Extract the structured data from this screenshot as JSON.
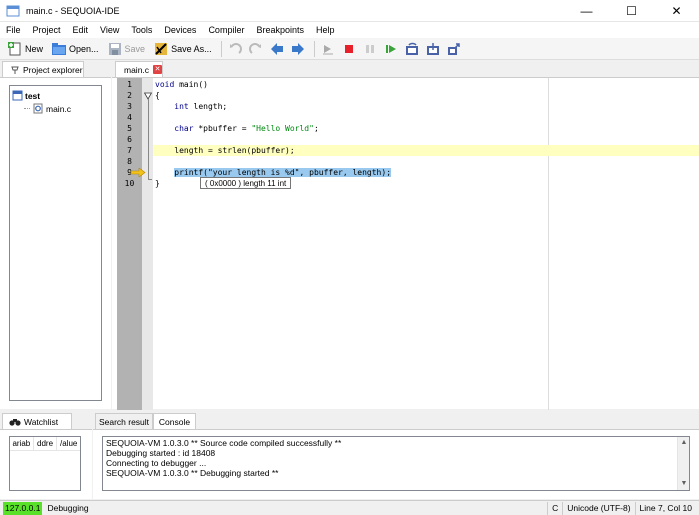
{
  "window": {
    "title": "main.c - SEQUOIA-IDE",
    "minimize": "—",
    "maximize": "☐",
    "close": "✕"
  },
  "menu": [
    "File",
    "Project",
    "Edit",
    "View",
    "Tools",
    "Devices",
    "Compiler",
    "Breakpoints",
    "Help"
  ],
  "toolbar": {
    "new_label": "New",
    "open_label": "Open...",
    "save_label": "Save",
    "save_as_label": "Save As..."
  },
  "project_explorer": {
    "tab_label": "Project explorer",
    "root": "test",
    "files": [
      "main.c"
    ]
  },
  "editor": {
    "tab_label": "main.c",
    "line_numbers": [
      "1",
      "2",
      "3",
      "4",
      "5",
      "6",
      "7",
      "8",
      "9",
      "10"
    ],
    "current_line": 7,
    "execution_line": 9,
    "tooltip": "( 0x0000 ) length 11 int"
  },
  "watchlist": {
    "tab_label": "Watchlist",
    "columns": [
      "ariab",
      "ddre",
      "/alue"
    ]
  },
  "bottom_tabs": {
    "search": "Search result",
    "console": "Console"
  },
  "console": {
    "lines": [
      "SEQUOIA-VM 1.0.3.0 ** Source code compiled successfully **",
      "Debugging started : id 18408",
      "Connecting to debugger ...",
      "SEQUOIA-VM 1.0.3.0 ** Debugging started **"
    ]
  },
  "status": {
    "ip": "127.0.0.1",
    "state": "Debugging",
    "mode": "C",
    "encoding": "Unicode (UTF-8)",
    "position": "Line 7, Col 10"
  },
  "colors": {
    "status_green": "#59e12a",
    "current_line": "#ffffc0",
    "selection": "#99c9ef"
  }
}
